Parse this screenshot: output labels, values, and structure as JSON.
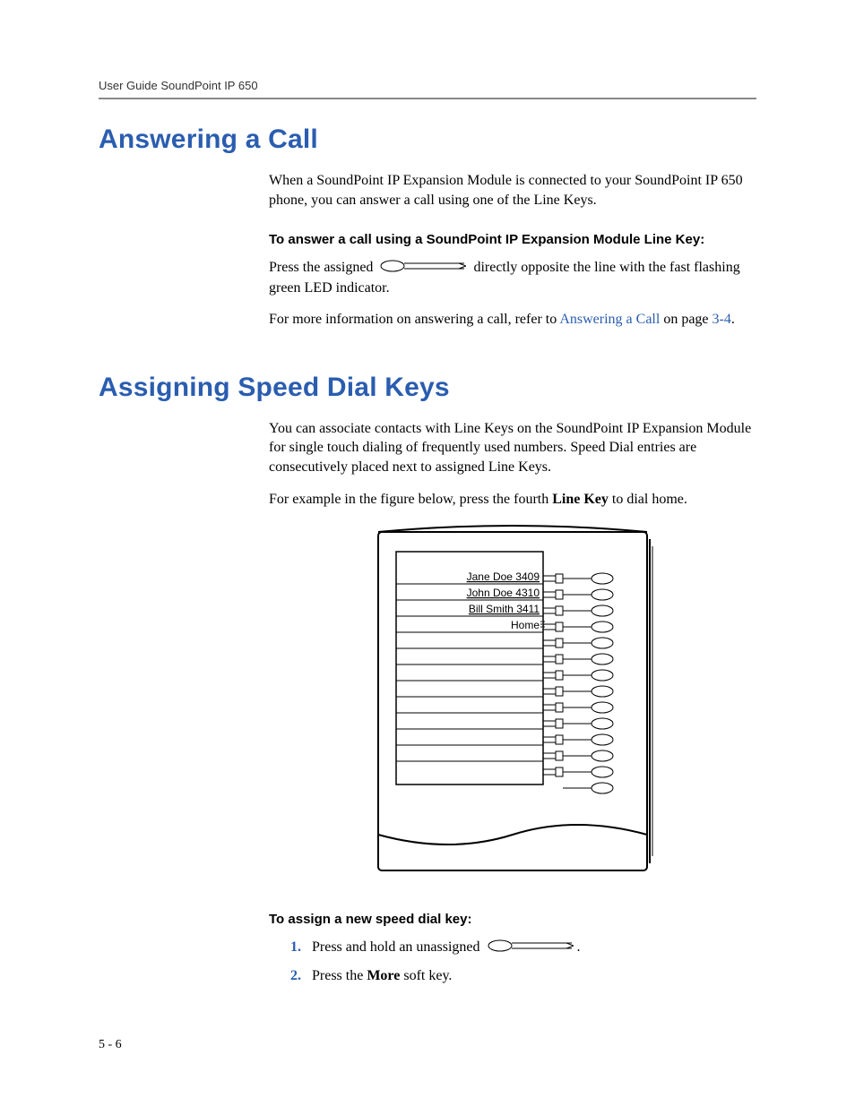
{
  "header": {
    "running_head": "User Guide SoundPoint IP 650"
  },
  "section1": {
    "title": "Answering a Call",
    "intro": "When a SoundPoint IP Expansion Module is connected to your SoundPoint IP 650 phone, you can answer a call using one of the Line Keys.",
    "subhead": "To answer a call using a SoundPoint IP Expansion Module Line Key:",
    "step_pre": "Press the assigned ",
    "step_post": " directly opposite the line with the fast flashing green LED indicator.",
    "more_pre": "For more information on answering a call, refer to ",
    "more_link": "Answering a Call",
    "more_mid": " on page ",
    "more_page": "3-4",
    "more_end": "."
  },
  "section2": {
    "title": "Assigning Speed Dial Keys",
    "p1": "You can associate contacts with Line Keys on the SoundPoint IP Expansion Module for single touch dialing of frequently used numbers. Speed Dial entries are consecutively placed next to assigned Line Keys.",
    "p2_pre": "For example in the figure below, press the fourth ",
    "p2_bold": "Line Key",
    "p2_post": " to dial home.",
    "figure_entries": {
      "r1": "Jane Doe 3409",
      "r2": "John Doe 4310",
      "r3": "Bill Smith 3411",
      "r4": "Home"
    },
    "subhead2": "To assign a new speed dial key:",
    "step1_num": "1.",
    "step1_text_pre": "Press and hold an unassigned ",
    "step1_text_post": ".",
    "step2_num": "2.",
    "step2_pre": "Press the ",
    "step2_bold": "More",
    "step2_post": " soft key."
  },
  "footer": {
    "page": "5 - 6"
  }
}
